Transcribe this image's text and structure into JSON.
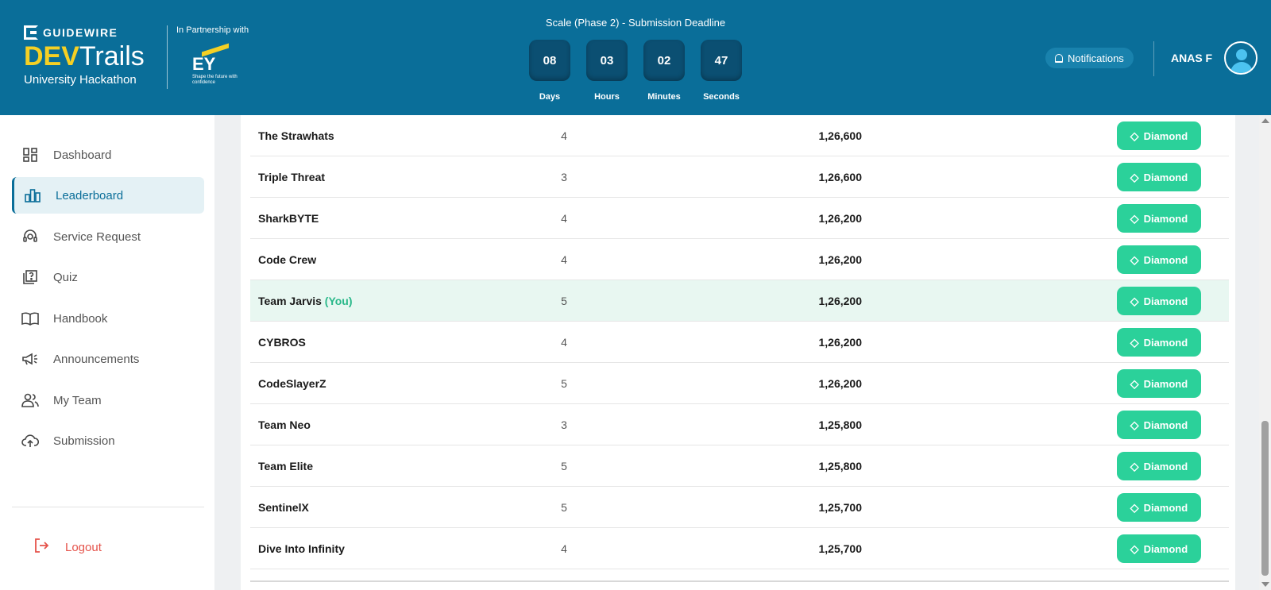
{
  "header": {
    "brand": {
      "company": "GUIDEWIRE",
      "dev": "DEV",
      "trails": "Trails",
      "subtitle": "University Hackathon"
    },
    "partnership": {
      "label": "In Partnership with",
      "partner": "EY",
      "tagline": "Shape the future with confidence"
    },
    "deadline_title": "Scale (Phase 2) - Submission Deadline",
    "timer": [
      {
        "value": "08",
        "label": "Days"
      },
      {
        "value": "03",
        "label": "Hours"
      },
      {
        "value": "02",
        "label": "Minutes"
      },
      {
        "value": "47",
        "label": "Seconds"
      }
    ],
    "notifications_label": "Notifications",
    "username": "ANAS F"
  },
  "sidebar": {
    "items": [
      {
        "label": "Dashboard",
        "icon": "dashboard-icon",
        "active": false
      },
      {
        "label": "Leaderboard",
        "icon": "bar-chart-icon",
        "active": true
      },
      {
        "label": "Service Request",
        "icon": "headset-icon",
        "active": false
      },
      {
        "label": "Quiz",
        "icon": "quiz-icon",
        "active": false
      },
      {
        "label": "Handbook",
        "icon": "book-icon",
        "active": false
      },
      {
        "label": "Announcements",
        "icon": "megaphone-icon",
        "active": false
      },
      {
        "label": "My Team",
        "icon": "team-icon",
        "active": false
      },
      {
        "label": "Submission",
        "icon": "cloud-upload-icon",
        "active": false
      }
    ],
    "logout_label": "Logout"
  },
  "leaderboard": {
    "you_tag": "(You)",
    "rows": [
      {
        "team": "The Strawhats",
        "members": "4",
        "score": "1,26,600",
        "tier": "Diamond",
        "is_you": false
      },
      {
        "team": "Triple Threat",
        "members": "3",
        "score": "1,26,600",
        "tier": "Diamond",
        "is_you": false
      },
      {
        "team": "SharkBYTE",
        "members": "4",
        "score": "1,26,200",
        "tier": "Diamond",
        "is_you": false
      },
      {
        "team": "Code Crew",
        "members": "4",
        "score": "1,26,200",
        "tier": "Diamond",
        "is_you": false
      },
      {
        "team": "Team Jarvis",
        "members": "5",
        "score": "1,26,200",
        "tier": "Diamond",
        "is_you": true
      },
      {
        "team": "CYBROS",
        "members": "4",
        "score": "1,26,200",
        "tier": "Diamond",
        "is_you": false
      },
      {
        "team": "CodeSlayerZ",
        "members": "5",
        "score": "1,26,200",
        "tier": "Diamond",
        "is_you": false
      },
      {
        "team": "Team Neo",
        "members": "3",
        "score": "1,25,800",
        "tier": "Diamond",
        "is_you": false
      },
      {
        "team": "Team Elite",
        "members": "5",
        "score": "1,25,800",
        "tier": "Diamond",
        "is_you": false
      },
      {
        "team": "SentinelX",
        "members": "5",
        "score": "1,25,700",
        "tier": "Diamond",
        "is_you": false
      },
      {
        "team": "Dive Into Infinity",
        "members": "4",
        "score": "1,25,700",
        "tier": "Diamond",
        "is_you": false
      }
    ]
  },
  "colors": {
    "header_bg": "#0a6e99",
    "accent_yellow": "#f5d024",
    "badge_green": "#2bd19a",
    "you_highlight": "#e8f7f1",
    "logout_red": "#e5534b"
  }
}
